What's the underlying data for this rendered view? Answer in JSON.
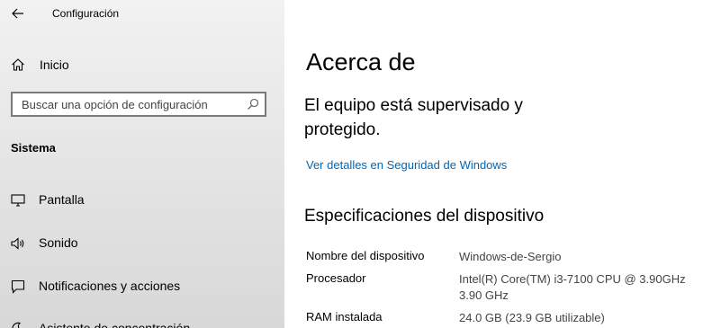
{
  "window": {
    "app_title": "Configuración"
  },
  "sidebar": {
    "home_label": "Inicio",
    "search_placeholder": "Buscar una opción de configuración",
    "section_label": "Sistema",
    "items": [
      {
        "label": "Pantalla",
        "icon": "monitor-icon"
      },
      {
        "label": "Sonido",
        "icon": "speaker-icon"
      },
      {
        "label": "Notificaciones y acciones",
        "icon": "message-icon"
      },
      {
        "label": "Asistente de concentración",
        "icon": "moon-icon"
      }
    ]
  },
  "main": {
    "title": "Acerca de",
    "protection_message": "El equipo está supervisado y protegido.",
    "security_link": "Ver detalles en Seguridad de Windows",
    "specs_heading": "Especificaciones del dispositivo",
    "specs": [
      {
        "key": "Nombre del dispositivo",
        "value": "Windows-de-Sergio"
      },
      {
        "key": "Procesador",
        "value": "Intel(R) Core(TM) i3-7100 CPU @ 3.90GHz 3.90 GHz"
      },
      {
        "key": "RAM instalada",
        "value": "24.0 GB (23.9 GB utilizable)"
      }
    ]
  },
  "colors": {
    "link": "#0067b8",
    "sidebar_bg": "#e6e6e6"
  }
}
